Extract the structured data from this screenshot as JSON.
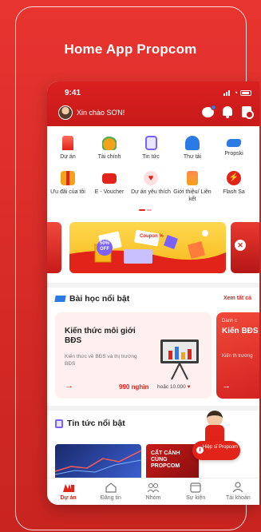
{
  "frame": {
    "title": "Home App Propcom"
  },
  "status": {
    "time": "9:41"
  },
  "header": {
    "greeting": "Xin chào SƠN!"
  },
  "categories_row1": [
    {
      "label": "Dự án",
      "icon": "building-icon",
      "color": "#e2231a"
    },
    {
      "label": "Tài chính",
      "icon": "money-bag-icon",
      "color": "#f2a21b"
    },
    {
      "label": "Tin tức",
      "icon": "news-icon",
      "color": "#7b61ff"
    },
    {
      "label": "Thư tải",
      "icon": "download-folder-icon",
      "color": "#2c7be5"
    },
    {
      "label": "Propski",
      "icon": "graduation-cap-icon",
      "color": "#2c7be5"
    }
  ],
  "categories_row2": [
    {
      "label": "Ưu đãi của tôi",
      "icon": "gift-icon",
      "color": "#f2a21b"
    },
    {
      "label": "E - Voucher",
      "icon": "voucher-icon",
      "color": "#e2231a"
    },
    {
      "label": "Dự án yêu thích",
      "icon": "heart-icon",
      "color": "#e2231a"
    },
    {
      "label": "Giới thiệu/ Liên kết",
      "icon": "referral-icon",
      "color": "#f2a21b"
    },
    {
      "label": "Flash Sa",
      "icon": "flash-sale-icon",
      "color": "#e2231a"
    }
  ],
  "banner": {
    "badge": "50% OFF",
    "coupon": "Coupon %"
  },
  "lessons": {
    "title": "Bài học nổi bật",
    "see_all": "Xem tất cả",
    "card": {
      "title": "Kiến thức môi giới BĐS",
      "desc": "Kiến thức về BĐS và thị trường BĐS",
      "price": "990 nghìn",
      "alt_price": "hoặc 10.000"
    },
    "side_card": {
      "small": "Dành c",
      "title": "Kiến BĐS",
      "desc": "Kiến th trường"
    }
  },
  "news": {
    "title": "Tin tức nổi bật",
    "item2_text": "CẤT CÁNH CÙNG PROPCOM"
  },
  "help": {
    "label": "Hiệp sĩ Propcom"
  },
  "tabs": [
    {
      "label": "Dự án",
      "icon": "home-logo-icon",
      "active": true
    },
    {
      "label": "Đăng tin",
      "icon": "house-post-icon",
      "active": false
    },
    {
      "label": "Nhóm",
      "icon": "group-icon",
      "active": false
    },
    {
      "label": "Sự kiện",
      "icon": "calendar-icon",
      "active": false
    },
    {
      "label": "Tài khoản",
      "icon": "person-icon",
      "active": false
    }
  ]
}
